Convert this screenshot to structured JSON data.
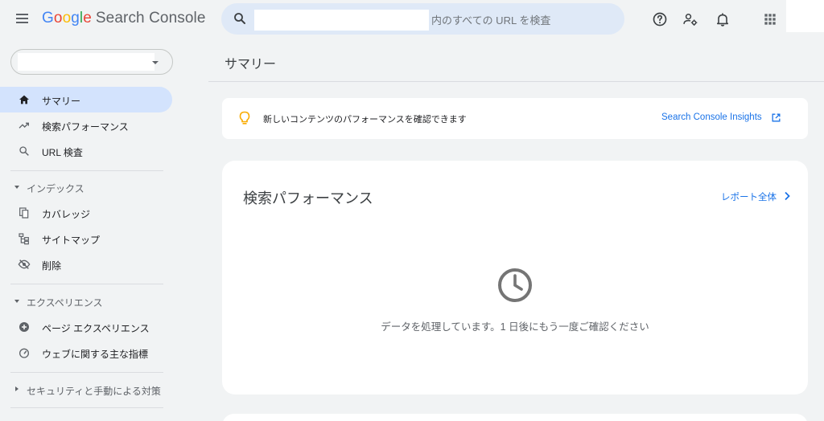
{
  "header": {
    "logo_letters": [
      "G",
      "o",
      "o",
      "g",
      "l",
      "e"
    ],
    "product_name": "Search Console",
    "search_placeholder": "内のすべての URL を検査",
    "icons": [
      "menu-icon",
      "search-icon",
      "help-icon",
      "manage-users-icon",
      "notifications-icon",
      "apps-icon"
    ]
  },
  "sidebar": {
    "items": [
      {
        "label": "サマリー",
        "icon": "home-icon",
        "active": true
      },
      {
        "label": "検索パフォーマンス",
        "icon": "trending-up-icon",
        "active": false
      },
      {
        "label": "URL 検査",
        "icon": "search-icon",
        "active": false
      }
    ],
    "sections": [
      {
        "label": "インデックス",
        "expanded": true,
        "items": [
          {
            "label": "カバレッジ",
            "icon": "coverage-icon"
          },
          {
            "label": "サイトマップ",
            "icon": "sitemap-icon"
          },
          {
            "label": "削除",
            "icon": "visibility-off-icon"
          }
        ]
      },
      {
        "label": "エクスペリエンス",
        "expanded": true,
        "items": [
          {
            "label": "ページ エクスペリエンス",
            "icon": "add-circle-icon"
          },
          {
            "label": "ウェブに関する主な指標",
            "icon": "speed-gauge-icon"
          }
        ]
      },
      {
        "label": "セキュリティと手動による対策",
        "expanded": false,
        "items": []
      }
    ]
  },
  "main": {
    "page_title": "サマリー",
    "insight": {
      "message": "新しいコンテンツのパフォーマンスを確認できます",
      "link_label": "Search Console Insights",
      "icon": "lightbulb-icon"
    },
    "performance": {
      "title": "検索パフォーマンス",
      "report_link": "レポート全体",
      "status_icon": "clock-icon",
      "status_message": "データを処理しています。1 日後にもう一度ご確認ください"
    }
  },
  "colors": {
    "background": "#f1f3f4",
    "active_nav": "#d3e3fd",
    "search_bg": "#dfe9f7",
    "link": "#1a73e8",
    "bulb": "#f9ab00",
    "icon_gray": "#5f6368"
  }
}
